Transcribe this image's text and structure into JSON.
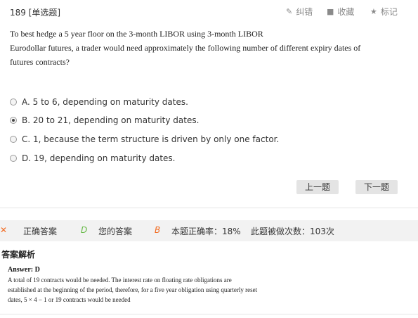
{
  "question": {
    "number": "189",
    "type": "[单选题]",
    "stem_lines": [
      "To best hedge a 5 year floor on the 3-month LIBOR using 3-month LIBOR",
      "Eurodollar futures, a trader would need approximately the following number of different expiry dates of",
      "futures contracts?"
    ]
  },
  "tools": {
    "correct_label": "纠错",
    "favorite_label": "收藏",
    "mark_label": "标记",
    "correct_icon": "pencil-icon",
    "favorite_icon": "bookmark-icon",
    "mark_icon": "star-icon"
  },
  "options": [
    {
      "text": "A. 5 to 6, depending on maturity dates.",
      "selected": false
    },
    {
      "text": "B. 20 to 21, depending on maturity dates.",
      "selected": true
    },
    {
      "text": "C. 1, because the term structure is driven by only one factor.",
      "selected": false
    },
    {
      "text": "D. 19, depending on maturity dates.",
      "selected": false
    }
  ],
  "nav": {
    "prev_label": "上一题",
    "next_label": "下一题"
  },
  "stats": {
    "wrong_icon": "✕",
    "correct_answer_label": "正确答案",
    "correct_answer_value": "D",
    "your_answer_label": "您的答案",
    "your_answer_value": "B",
    "accuracy_text": "本题正确率：18%",
    "attempts_text": "此题被做次数：103次",
    "colors": {
      "wrong": "#f26a20",
      "correct": "#63b843",
      "yours": "#f26a20"
    }
  },
  "analysis": {
    "title": "答案解析",
    "answer_label": "Answer: D",
    "lines": [
      "A total of 19 contracts would be needed. The interest rate on floating rate obligations are",
      "established at the beginning of the period, therefore, for a five year obligation using quarterly reset",
      "dates,  5 × 4 − 1  or 19 contracts would be needed"
    ]
  }
}
